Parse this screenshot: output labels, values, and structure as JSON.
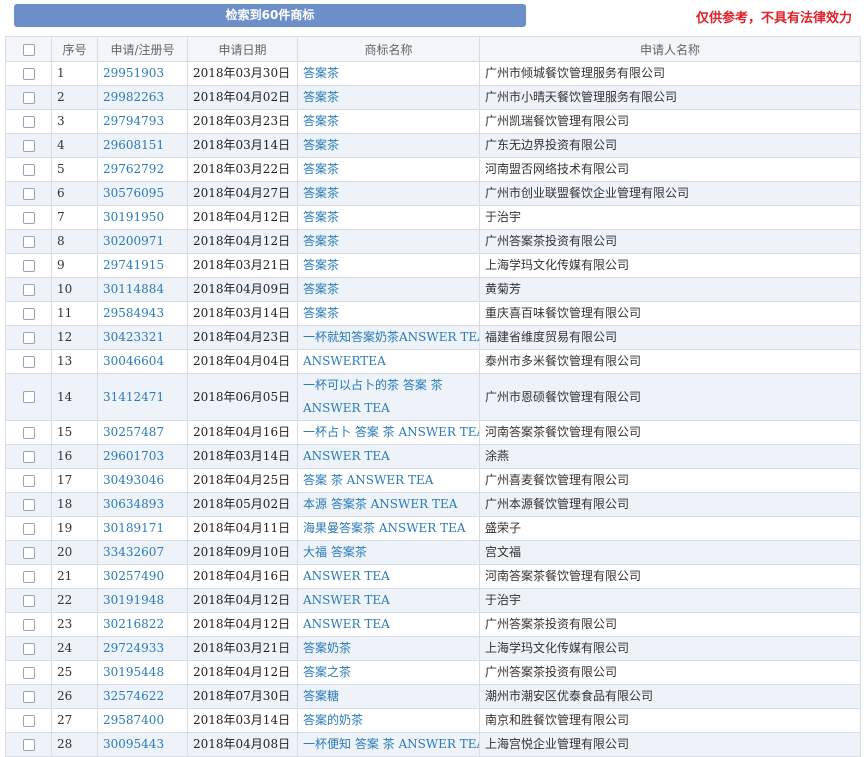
{
  "header": {
    "banner": "检索到60件商标",
    "disclaimer": "仅供参考，不具有法律效力"
  },
  "table": {
    "columns": [
      "序号",
      "申请/注册号",
      "申请日期",
      "商标名称",
      "申请人名称"
    ],
    "rows": [
      {
        "seq": "1",
        "reg_no": "29951903",
        "date": "2018年03月30日",
        "mark": "答案茶",
        "applicant": "广州市倾城餐饮管理服务有限公司"
      },
      {
        "seq": "2",
        "reg_no": "29982263",
        "date": "2018年04月02日",
        "mark": "答案茶",
        "applicant": "广州市小晴天餐饮管理服务有限公司"
      },
      {
        "seq": "3",
        "reg_no": "29794793",
        "date": "2018年03月23日",
        "mark": "答案茶",
        "applicant": "广州凯瑞餐饮管理有限公司"
      },
      {
        "seq": "4",
        "reg_no": "29608151",
        "date": "2018年03月14日",
        "mark": "答案茶",
        "applicant": "广东无边界投资有限公司"
      },
      {
        "seq": "5",
        "reg_no": "29762792",
        "date": "2018年03月22日",
        "mark": "答案茶",
        "applicant": "河南盟否网络技术有限公司"
      },
      {
        "seq": "6",
        "reg_no": "30576095",
        "date": "2018年04月27日",
        "mark": "答案茶",
        "applicant": "广州市创业联盟餐饮企业管理有限公司"
      },
      {
        "seq": "7",
        "reg_no": "30191950",
        "date": "2018年04月12日",
        "mark": "答案茶",
        "applicant": "于治宇"
      },
      {
        "seq": "8",
        "reg_no": "30200971",
        "date": "2018年04月12日",
        "mark": "答案茶",
        "applicant": "广州答案茶投资有限公司"
      },
      {
        "seq": "9",
        "reg_no": "29741915",
        "date": "2018年03月21日",
        "mark": "答案茶",
        "applicant": "上海学玛文化传媒有限公司"
      },
      {
        "seq": "10",
        "reg_no": "30114884",
        "date": "2018年04月09日",
        "mark": "答案茶",
        "applicant": "黄菊芳"
      },
      {
        "seq": "11",
        "reg_no": "29584943",
        "date": "2018年03月14日",
        "mark": "答案茶",
        "applicant": "重庆喜百味餐饮管理有限公司"
      },
      {
        "seq": "12",
        "reg_no": "30423321",
        "date": "2018年04月23日",
        "mark": "一杯就知答案奶茶ANSWER TEA",
        "applicant": "福建省维度贸易有限公司"
      },
      {
        "seq": "13",
        "reg_no": "30046604",
        "date": "2018年04月04日",
        "mark": "ANSWERTEA",
        "applicant": "泰州市多米餐饮管理有限公司"
      },
      {
        "seq": "14",
        "reg_no": "31412471",
        "date": "2018年06月05日",
        "mark": "一杯可以占卜的茶 答案 茶 ANSWER TEA",
        "applicant": "广州市恩硕餐饮管理有限公司"
      },
      {
        "seq": "15",
        "reg_no": "30257487",
        "date": "2018年04月16日",
        "mark": "一杯占卜 答案 茶 ANSWER TEAS",
        "applicant": "河南答案茶餐饮管理有限公司"
      },
      {
        "seq": "16",
        "reg_no": "29601703",
        "date": "2018年03月14日",
        "mark": "ANSWER TEA",
        "applicant": "涂燕"
      },
      {
        "seq": "17",
        "reg_no": "30493046",
        "date": "2018年04月25日",
        "mark": "答案 茶 ANSWER TEA",
        "applicant": "广州喜麦餐饮管理有限公司"
      },
      {
        "seq": "18",
        "reg_no": "30634893",
        "date": "2018年05月02日",
        "mark": "本源 答案茶 ANSWER TEA",
        "applicant": "广州本源餐饮管理有限公司"
      },
      {
        "seq": "19",
        "reg_no": "30189171",
        "date": "2018年04月11日",
        "mark": "海果曼答案茶 ANSWER TEA",
        "applicant": "盛荣子"
      },
      {
        "seq": "20",
        "reg_no": "33432607",
        "date": "2018年09月10日",
        "mark": "大福 答案茶",
        "applicant": "宫文福"
      },
      {
        "seq": "21",
        "reg_no": "30257490",
        "date": "2018年04月16日",
        "mark": "ANSWER TEA",
        "applicant": "河南答案茶餐饮管理有限公司"
      },
      {
        "seq": "22",
        "reg_no": "30191948",
        "date": "2018年04月12日",
        "mark": "ANSWER TEA",
        "applicant": "于治宇"
      },
      {
        "seq": "23",
        "reg_no": "30216822",
        "date": "2018年04月12日",
        "mark": "ANSWER TEA",
        "applicant": "广州答案茶投资有限公司"
      },
      {
        "seq": "24",
        "reg_no": "29724933",
        "date": "2018年03月21日",
        "mark": "答案奶茶",
        "applicant": "上海学玛文化传媒有限公司"
      },
      {
        "seq": "25",
        "reg_no": "30195448",
        "date": "2018年04月12日",
        "mark": "答案之茶",
        "applicant": "广州答案茶投资有限公司"
      },
      {
        "seq": "26",
        "reg_no": "32574622",
        "date": "2018年07月30日",
        "mark": "答案糖",
        "applicant": "潮州市潮安区优泰食品有限公司"
      },
      {
        "seq": "27",
        "reg_no": "29587400",
        "date": "2018年03月14日",
        "mark": "答案的奶茶",
        "applicant": "南京和胜餐饮管理有限公司"
      },
      {
        "seq": "28",
        "reg_no": "30095443",
        "date": "2018年04月08日",
        "mark": "一杯便知 答案 茶 ANSWER TEA",
        "applicant": "上海宫悦企业管理有限公司"
      }
    ]
  }
}
